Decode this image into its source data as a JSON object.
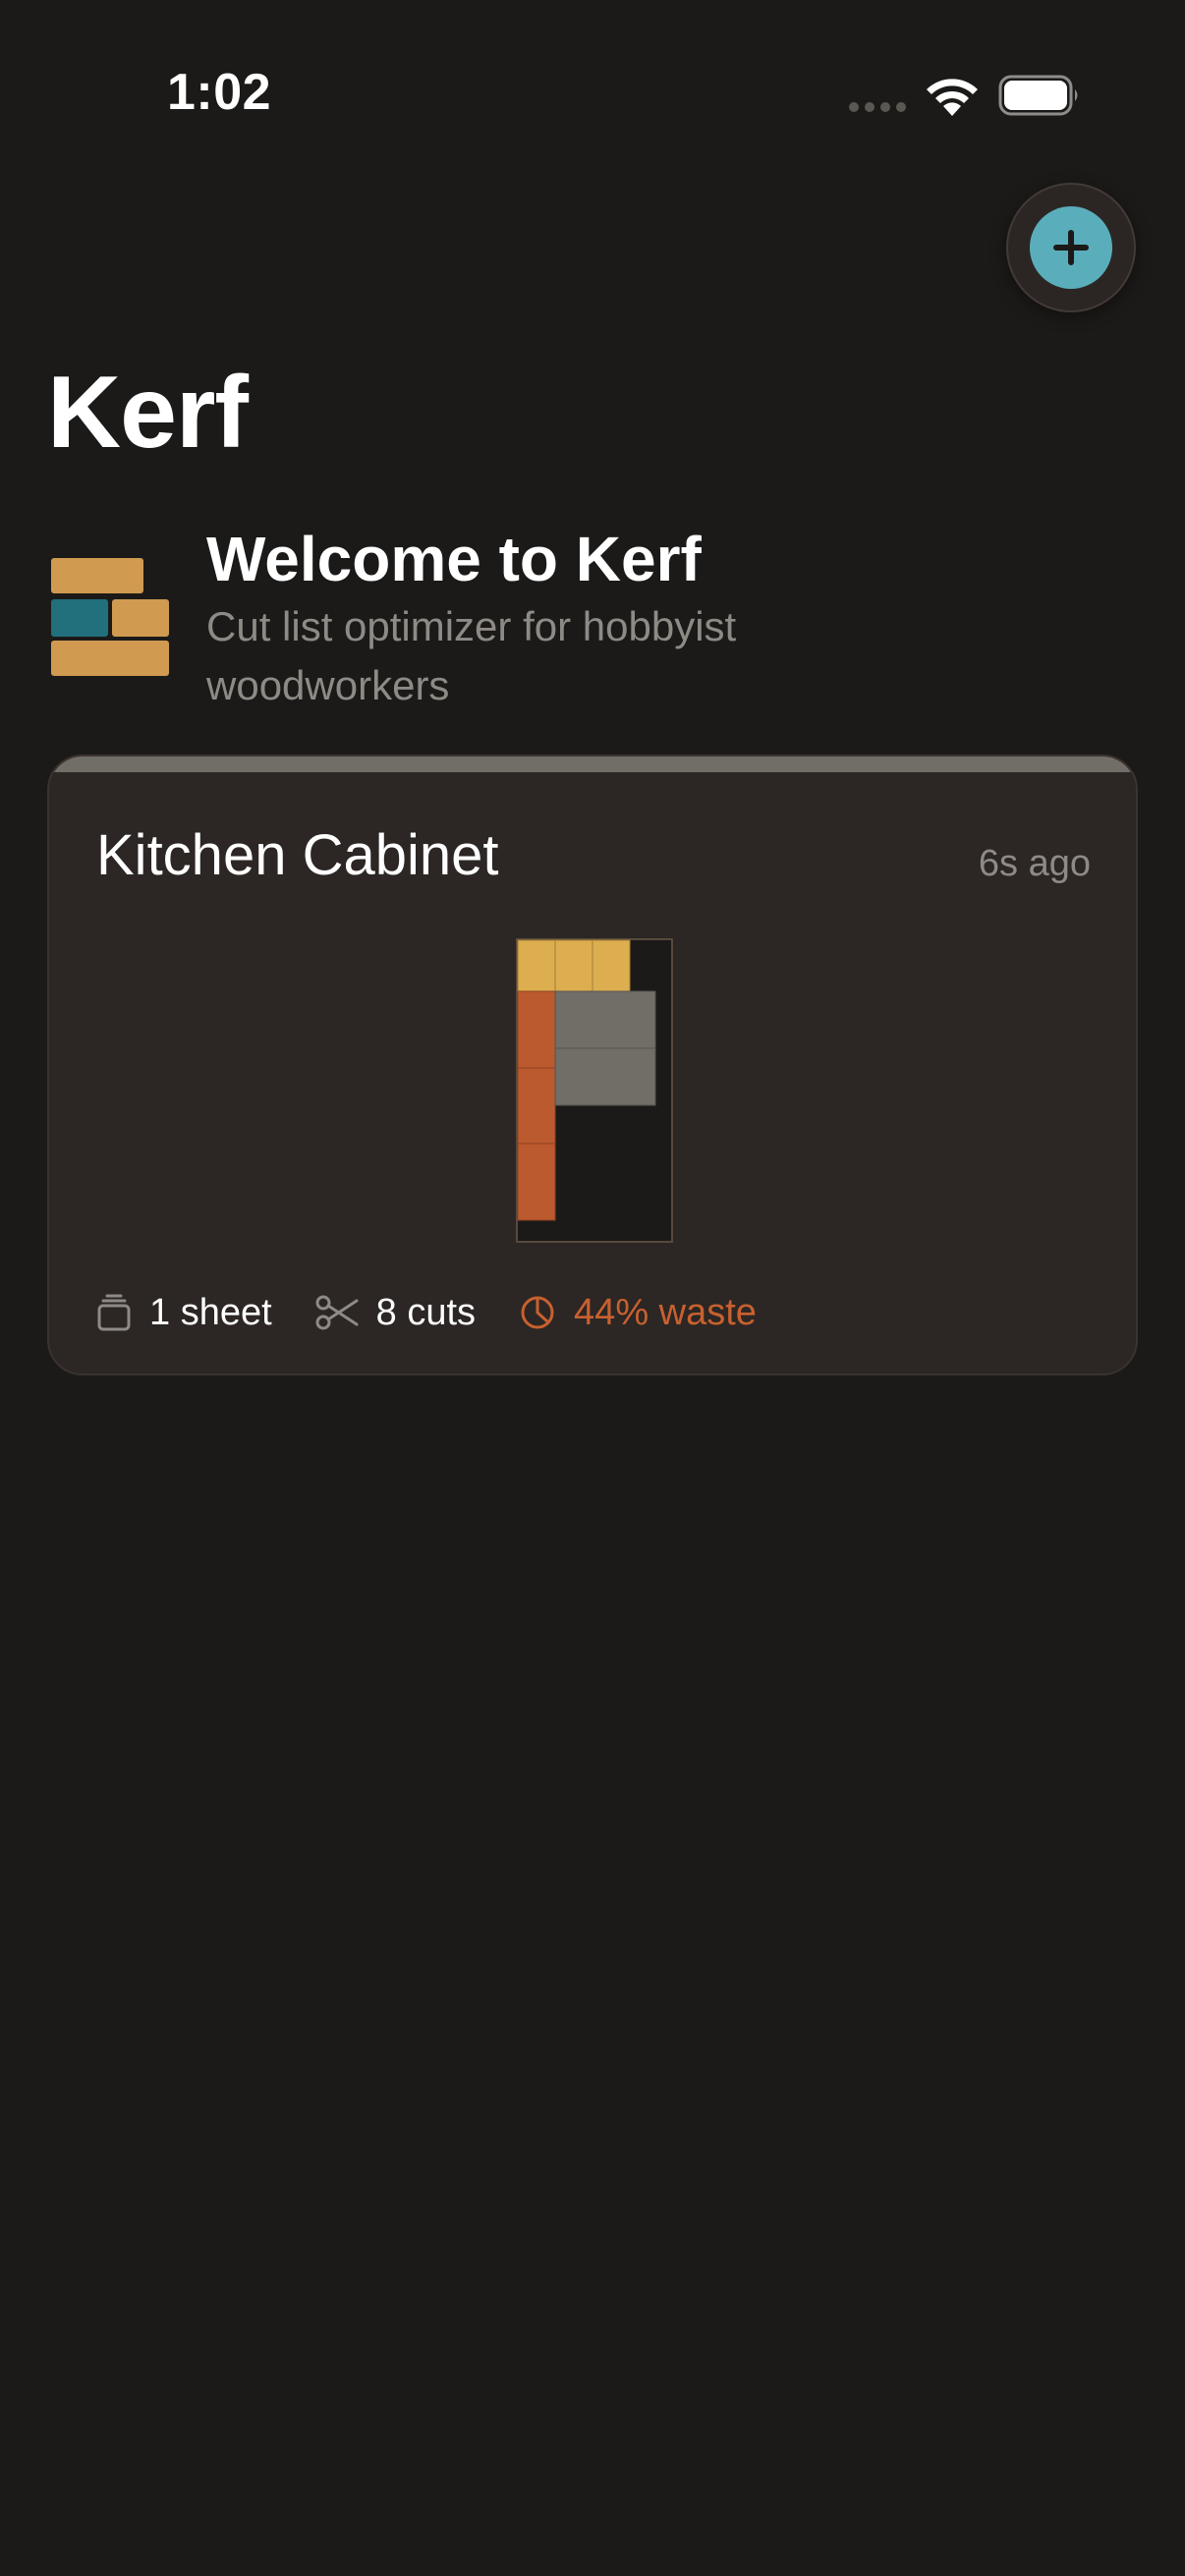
{
  "status_bar": {
    "time": "1:02",
    "icons": [
      "cellular-signal-icon",
      "wifi-icon",
      "battery-icon"
    ]
  },
  "actions": {
    "add_icon": "plus-icon"
  },
  "page": {
    "title": "Kerf"
  },
  "welcome": {
    "logo_icon": "stacked-boards-logo",
    "heading": "Welcome to Kerf",
    "subtitle": "Cut list optimizer for hobbyist woodworkers"
  },
  "projects": [
    {
      "name": "Kitchen Cabinet",
      "updated": "6s ago",
      "sheets_label": "1 sheet",
      "cuts_label": "8 cuts",
      "waste_label": "44% waste",
      "waste_percent": 44,
      "stat_icons": [
        "stack-icon",
        "scissors-icon",
        "pie-chart-icon"
      ]
    }
  ],
  "colors": {
    "background": "#1c1a18",
    "card": "#2c2624",
    "accent": "#5aaebb",
    "waste": "#c7612f",
    "part_yellow": "#dcae50",
    "part_orange": "#bb5a2e",
    "part_gray": "#716d67",
    "logo_tan": "#d09a50",
    "logo_teal": "#22707c"
  }
}
